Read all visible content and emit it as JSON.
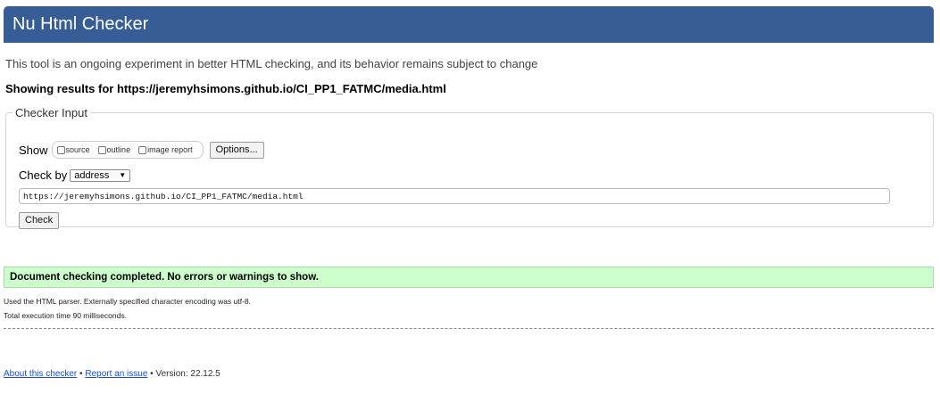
{
  "header": {
    "title": "Nu Html Checker"
  },
  "tagline": "This tool is an ongoing experiment in better HTML checking, and its behavior remains subject to change",
  "results_heading": "Showing results for https://jeremyhsimons.github.io/CI_PP1_FATMC/media.html",
  "checker_input": {
    "legend": "Checker Input",
    "show_label": "Show",
    "options": [
      {
        "label": "source",
        "checked": false
      },
      {
        "label": "outline",
        "checked": false
      },
      {
        "label": "image report",
        "checked": false
      }
    ],
    "options_button": "Options...",
    "check_by_label": "Check by",
    "check_by_value": "address",
    "url_value": "https://jeremyhsimons.github.io/CI_PP1_FATMC/media.html",
    "check_button": "Check"
  },
  "result": {
    "message": "Document checking completed. No errors or warnings to show.",
    "details": [
      "Used the HTML parser. Externally specified character encoding was utf-8.",
      "Total execution time 90 milliseconds."
    ],
    "success_color": "#ccffcc"
  },
  "footer": {
    "about_link": "About this checker",
    "separator": "•",
    "report_link": "Report an issue",
    "version_text": "Version: 22.12.5"
  },
  "colors": {
    "header": "#365d95",
    "link": "#1a4fd6"
  }
}
